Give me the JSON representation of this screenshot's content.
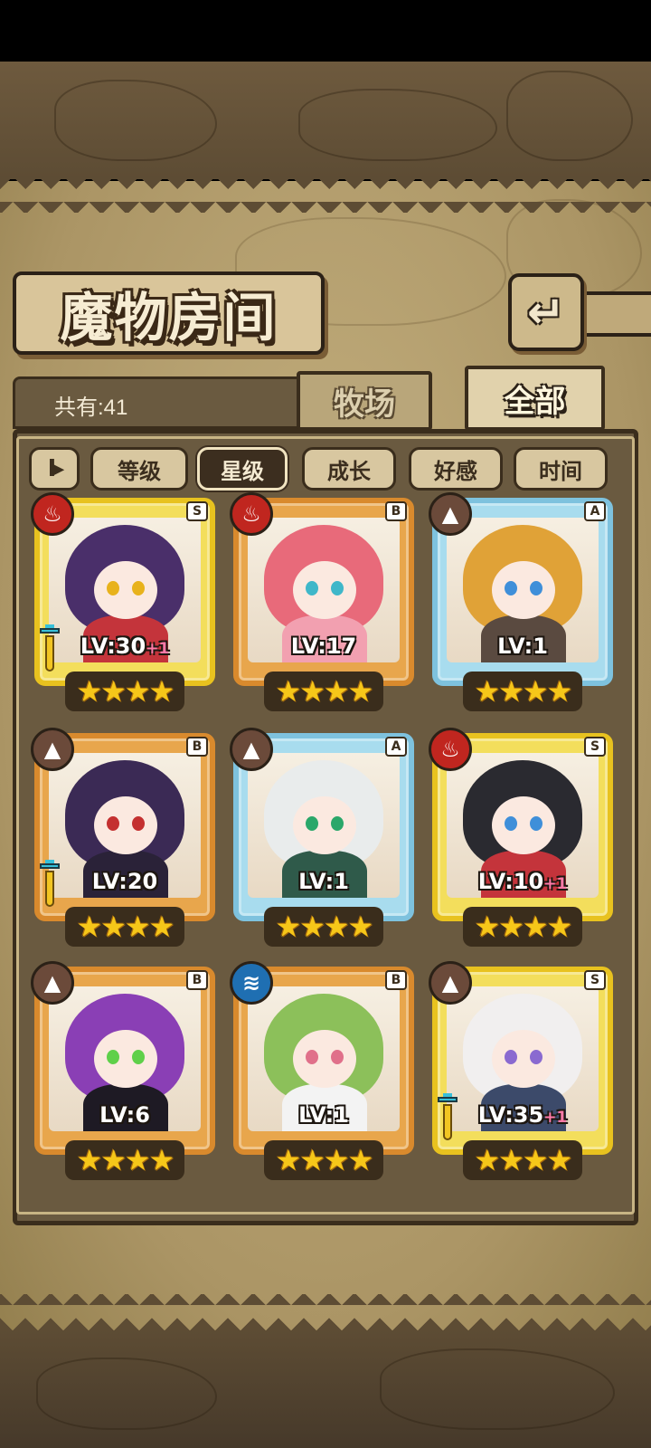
{
  "header": {
    "title": "魔物房间",
    "back_icon": "↵"
  },
  "summary": {
    "count_label": "共有:41"
  },
  "tabs": [
    {
      "label": "牧场",
      "active": false
    },
    {
      "label": "全部",
      "active": true
    }
  ],
  "filters": {
    "sort_icon": "I▸",
    "items": [
      {
        "label": "等级",
        "active": false
      },
      {
        "label": "星级",
        "active": true
      },
      {
        "label": "成长",
        "active": false
      },
      {
        "label": "好感",
        "active": false
      },
      {
        "label": "时间",
        "active": false
      }
    ]
  },
  "monsters": [
    {
      "element": "fire",
      "element_icon": "♨",
      "rank": "S",
      "level": "LV:30",
      "bonus": "+1",
      "stars": "★★★★",
      "has_weapon": true,
      "frame": "gold",
      "hair_color": "#4a2f6a",
      "body_color": "#c4343b",
      "eye_color": "#e8b21c"
    },
    {
      "element": "fire",
      "element_icon": "♨",
      "rank": "B",
      "level": "LV:17",
      "bonus": "",
      "stars": "★★★★",
      "has_weapon": false,
      "frame": "bronze",
      "hair_color": "#e86a7a",
      "body_color": "#f2a0b0",
      "eye_color": "#3fb7c9"
    },
    {
      "element": "earth",
      "element_icon": "▲",
      "rank": "A",
      "level": "LV:1",
      "bonus": "",
      "stars": "★★★★",
      "has_weapon": false,
      "frame": "silver",
      "hair_color": "#e0a237",
      "body_color": "#5a4a40",
      "eye_color": "#3f8fd9"
    },
    {
      "element": "earth",
      "element_icon": "▲",
      "rank": "B",
      "level": "LV:20",
      "bonus": "",
      "stars": "★★★★",
      "has_weapon": true,
      "frame": "bronze",
      "hair_color": "#3b2a55",
      "body_color": "#2a2238",
      "eye_color": "#c43030"
    },
    {
      "element": "earth",
      "element_icon": "▲",
      "rank": "A",
      "level": "LV:1",
      "bonus": "",
      "stars": "★★★★",
      "has_weapon": false,
      "frame": "silver",
      "hair_color": "#e9ecec",
      "body_color": "#2f5a4a",
      "eye_color": "#2aa76a"
    },
    {
      "element": "fire",
      "element_icon": "♨",
      "rank": "S",
      "level": "LV:10",
      "bonus": "+1",
      "stars": "★★★★",
      "has_weapon": false,
      "frame": "gold",
      "hair_color": "#2a2a30",
      "body_color": "#c4343b",
      "eye_color": "#3f8fd9"
    },
    {
      "element": "earth",
      "element_icon": "▲",
      "rank": "B",
      "level": "LV:6",
      "bonus": "",
      "stars": "★★★★",
      "has_weapon": false,
      "frame": "bronze",
      "hair_color": "#8a3fb5",
      "body_color": "#1e1a24",
      "eye_color": "#5fd04a"
    },
    {
      "element": "water",
      "element_icon": "≋",
      "rank": "B",
      "level": "LV:1",
      "bonus": "",
      "stars": "★★★★",
      "has_weapon": false,
      "frame": "bronze",
      "hair_color": "#8cc05a",
      "body_color": "#f3f3f3",
      "eye_color": "#e0708a"
    },
    {
      "element": "earth",
      "element_icon": "▲",
      "rank": "S",
      "level": "LV:35",
      "bonus": "+1",
      "stars": "★★★★",
      "has_weapon": true,
      "frame": "gold",
      "hair_color": "#f1efef",
      "body_color": "#3c4a6a",
      "eye_color": "#8a6ad0"
    }
  ]
}
